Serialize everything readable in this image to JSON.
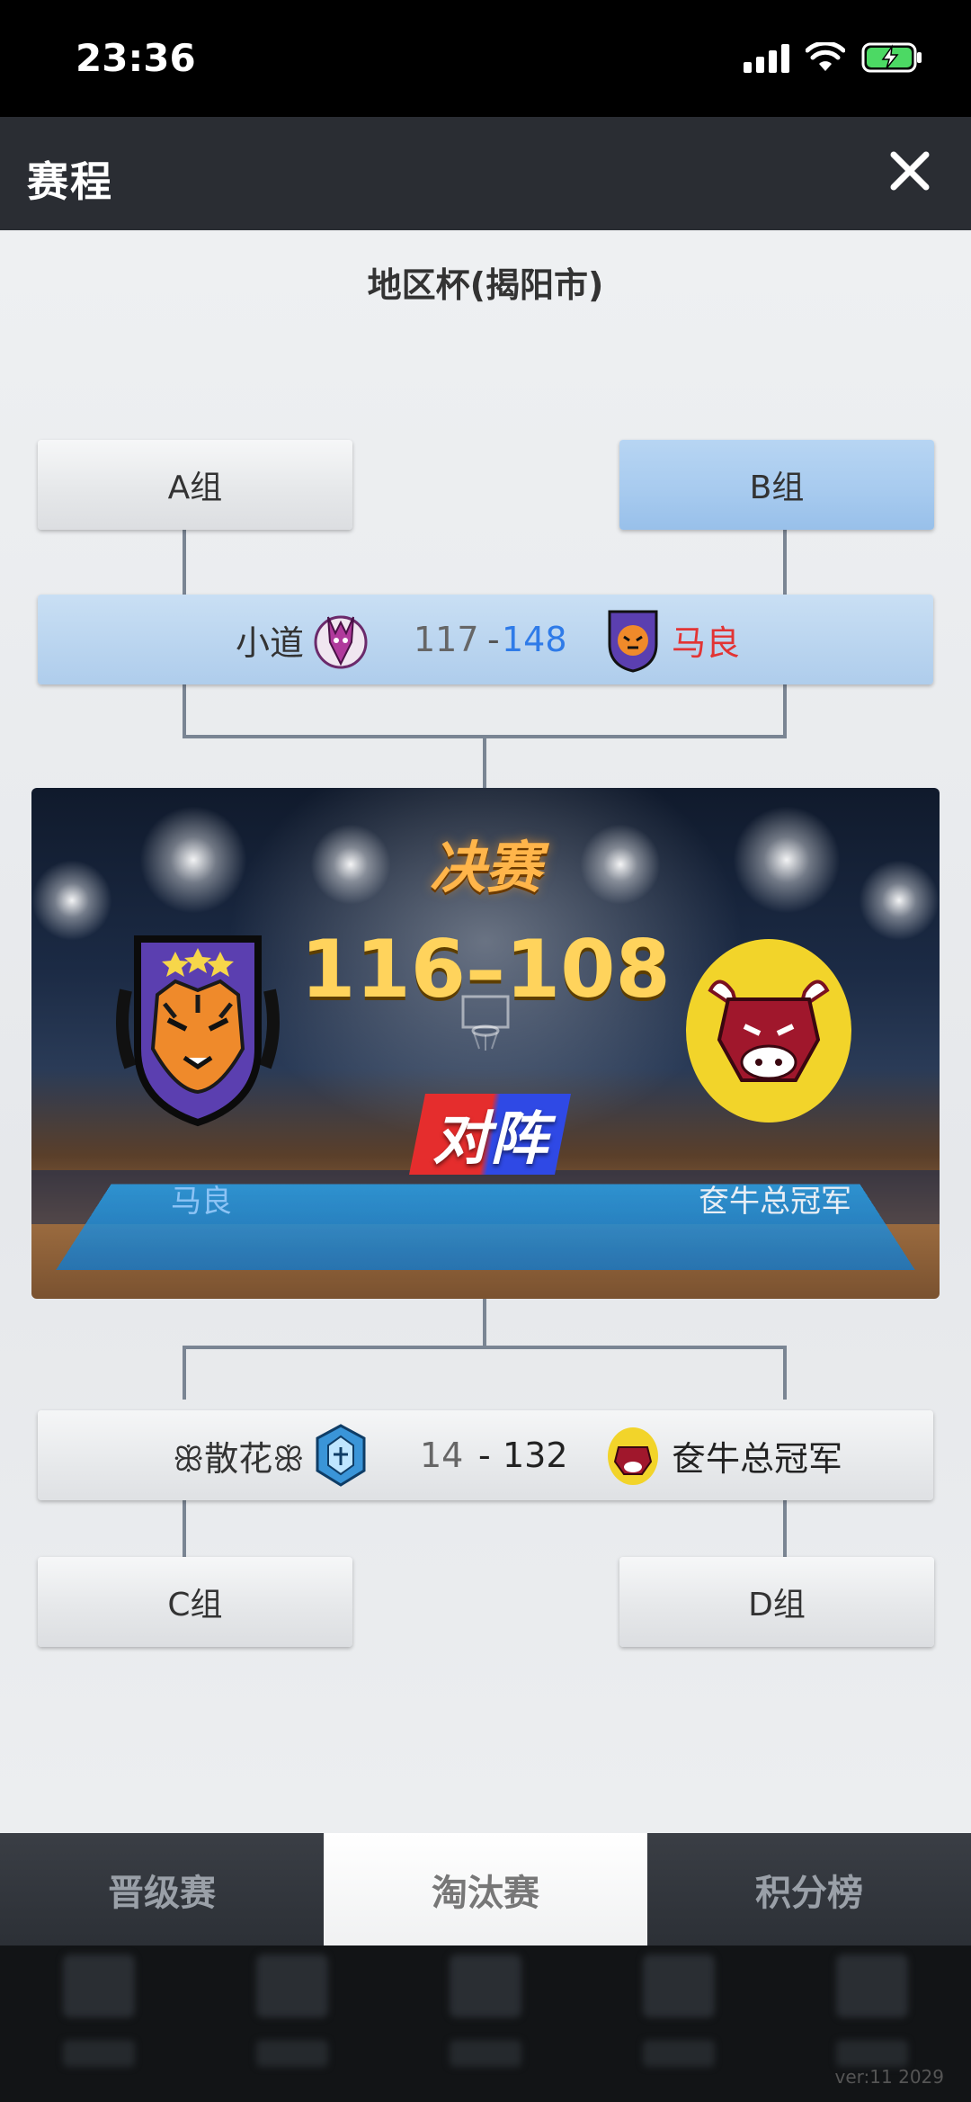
{
  "status_bar": {
    "time": "23:36"
  },
  "header": {
    "title": "赛程"
  },
  "cup": {
    "title": "地区杯(揭阳市)"
  },
  "groups": {
    "a": "A组",
    "b": "B组",
    "c": "C组",
    "d": "D组"
  },
  "semi_top": {
    "team1": "小道",
    "score1": "117",
    "dash": "-",
    "score2": "148",
    "team2": "马良"
  },
  "final": {
    "label": "决赛",
    "score": "116–108",
    "vs": "对阵",
    "team1": "马良",
    "team2": "奁牛总冠军"
  },
  "semi_bottom": {
    "team1": "ꕥ散花ꕥ",
    "score1": "14",
    "dash": "-",
    "score2": "132",
    "team2": "奁牛总冠军"
  },
  "tabs": [
    "晋级赛",
    "淘汰赛",
    "积分榜"
  ],
  "active_tab": 1,
  "version": "ver:11  2029",
  "colors": {
    "winner_blue": "#2f7be8",
    "winner_red": "#e23434",
    "final_gold": "#ffd35c"
  }
}
